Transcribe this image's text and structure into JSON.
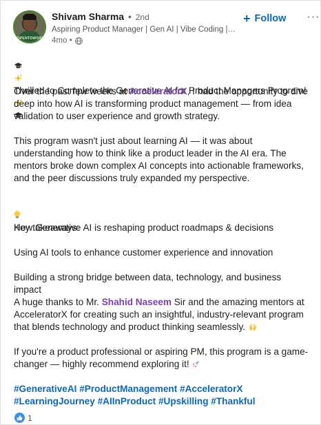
{
  "post": {
    "author": {
      "name": "Shivam Sharma",
      "separator": "•",
      "degree": "2nd",
      "headline": "Aspiring Product Manager | Gen AI | Vibe Coding | UI/...",
      "time": "4mo •",
      "avatar_text": "#OPENTOWORK"
    },
    "follow_label": "Follow",
    "more_label": "···",
    "body": {
      "intro_text": "Thrilled to Complete the Generative AI for Product Managers Program!",
      "p2_before": "Over the past few weeks at ",
      "p2_mention": "AcceleratorX",
      "p2_after": ", I had the opportunity to dive deep into how AI is transforming product management — from idea validation to user experience and growth strategy.",
      "p3": "This program wasn't just about learning AI — it was about understanding how to think like a product leader in the AI era. The mentors broke down complex AI concepts into actionable frameworks, and the peer discussions truly expanded my perspective.",
      "p4": "Key takeaways:",
      "p5": "How Generative AI is reshaping product roadmaps & decisions",
      "p6": "Using AI tools to enhance customer experience and innovation",
      "p7": "Building a strong bridge between data, technology, and business impact",
      "p8_before": "A huge thanks to Mr. ",
      "p8_mention": "Shahid Naseem",
      "p8_after": " Sir and the amazing mentors at AcceleratorX for creating such an insightful, industry-relevant program that blends technology and product thinking seamlessly.",
      "p9": "If you're a product professional or aspiring PM, this program is a game-changer — highly recommend exploring it!",
      "hashtags": [
        "#GenerativeAI",
        "#ProductManagement",
        "#AcceleratorX",
        "#LearningJourney",
        "#AIInProduct",
        "#Upskilling",
        "#Thankful"
      ]
    },
    "reactions": {
      "count": "1"
    },
    "icons": {
      "intro": [
        "graduation-cap-icon",
        "sparkles-icon"
      ],
      "key_takeaways": "light-bulb-icon",
      "thanks": "raising-hands-icon",
      "recommend": "rocket-icon",
      "visibility": "globe-icon",
      "reaction": "like-icon"
    },
    "colors": {
      "link_blue": "#0a66c2",
      "mention_purple": "#7b3fb0"
    }
  }
}
